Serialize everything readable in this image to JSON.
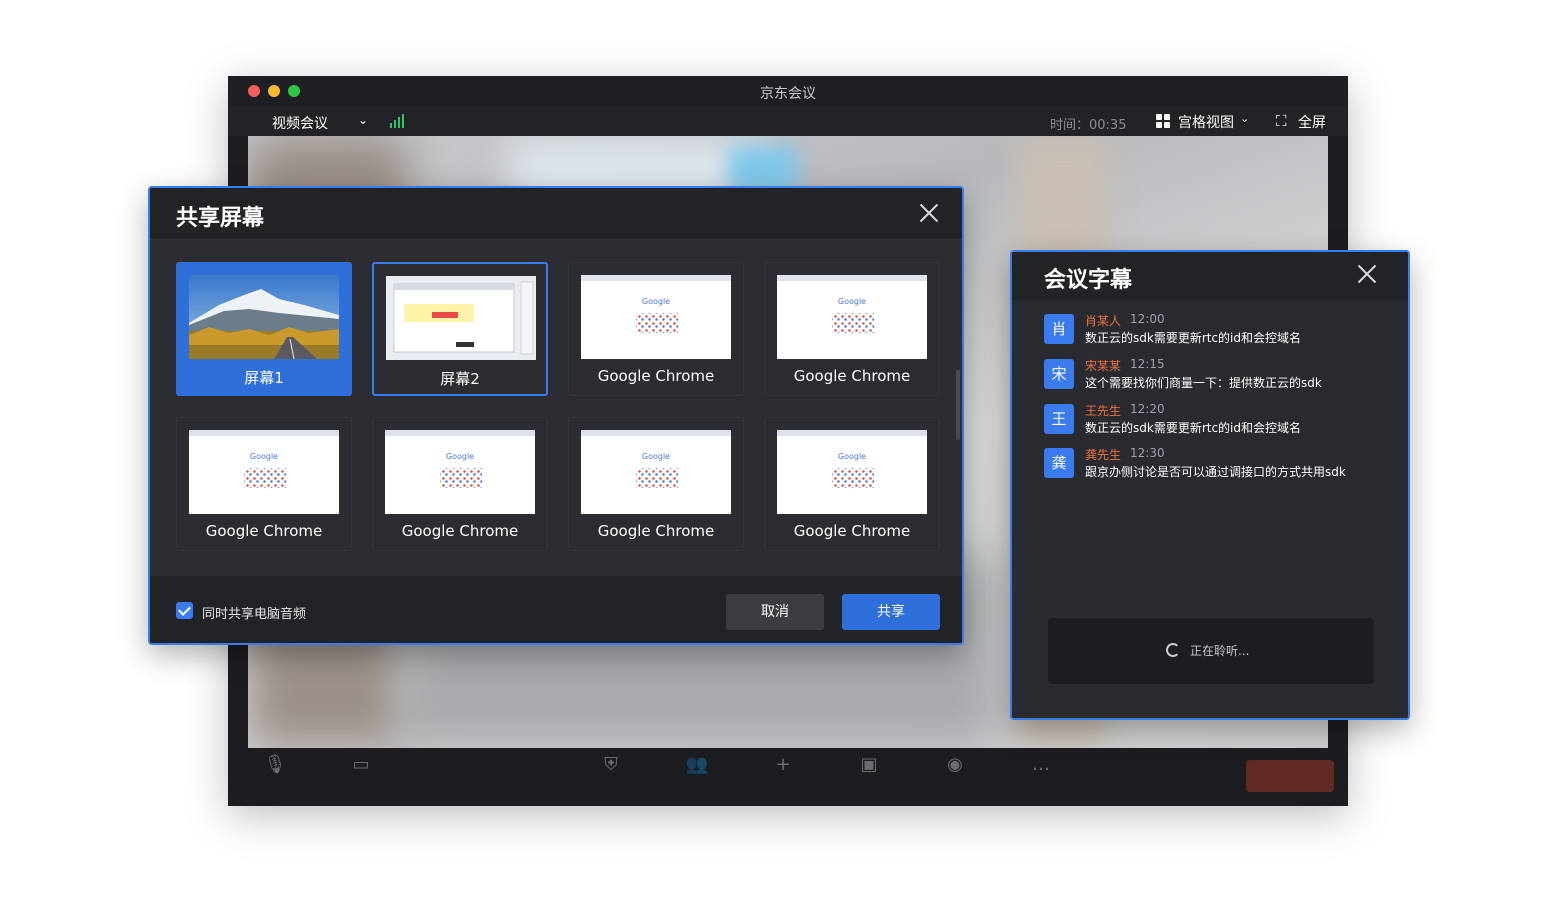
{
  "window": {
    "title": "京东会议",
    "meeting_type": "视频会议",
    "time_label": "时间：00:35",
    "grid_view_label": "宫格视图",
    "fullscreen_label": "全屏"
  },
  "share_dialog": {
    "title": "共享屏幕",
    "tiles": [
      {
        "label": "屏幕1",
        "kind": "landscape",
        "state": "selected"
      },
      {
        "label": "屏幕2",
        "kind": "screen",
        "state": "hover"
      },
      {
        "label": "Google Chrome",
        "kind": "chrome",
        "state": "normal"
      },
      {
        "label": "Google Chrome",
        "kind": "chrome",
        "state": "normal"
      },
      {
        "label": "Google Chrome",
        "kind": "chrome",
        "state": "normal"
      },
      {
        "label": "Google Chrome",
        "kind": "chrome",
        "state": "normal"
      },
      {
        "label": "Google Chrome",
        "kind": "chrome",
        "state": "normal"
      },
      {
        "label": "Google Chrome",
        "kind": "chrome",
        "state": "normal"
      }
    ],
    "audio_checkbox_label": "同时共享电脑音频",
    "audio_checked": true,
    "cancel_label": "取消",
    "share_label": "共享"
  },
  "caption_panel": {
    "title": "会议字幕",
    "messages": [
      {
        "avatar": "肖",
        "name": "肖某人",
        "time": "12:00",
        "text": "数正云的sdk需要更新rtc的id和会控域名"
      },
      {
        "avatar": "宋",
        "name": "宋某某",
        "time": "12:15",
        "text": "这个需要找你们商量一下：提供数正云的sdk"
      },
      {
        "avatar": "王",
        "name": "王先生",
        "time": "12:20",
        "text": "数正云的sdk需要更新rtc的id和会控域名"
      },
      {
        "avatar": "龚",
        "name": "龚先生",
        "time": "12:30",
        "text": "跟京办侧讨论是否可以通过调接口的方式共用sdk"
      }
    ],
    "listening_text": "正在聆听..."
  },
  "colors": {
    "accent": "#3a7bf0",
    "name_orange": "#f0703a",
    "signal_green": "#2ec46b"
  }
}
